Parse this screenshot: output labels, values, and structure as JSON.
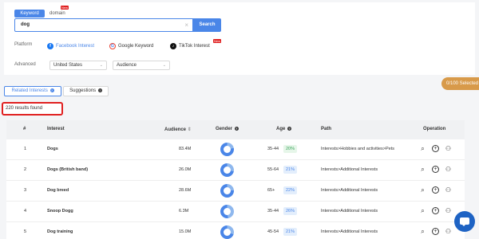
{
  "search": {
    "tabs": [
      "Keyword",
      "domain"
    ],
    "new_badge": "New",
    "query": "dog",
    "button_label": "Search"
  },
  "platform": {
    "label": "Platform",
    "items": [
      "Facebook Interest",
      "Google Keyword",
      "TikTok Interest"
    ],
    "new_badge": "New"
  },
  "advanced": {
    "label": "Advanced",
    "country": "United States",
    "audience": "Audience"
  },
  "tabs": {
    "related": "Related Interests",
    "suggestions": "Suggestions"
  },
  "selected": "0/100 Selected",
  "results_text": "220 results found",
  "table": {
    "headers": [
      "#",
      "Interest",
      "Audience",
      "Gender",
      "Age",
      "Path",
      "Operation"
    ],
    "rows": [
      {
        "num": "1",
        "interest": "Dogs",
        "audience": "83.4M",
        "age": "35-44",
        "pct": "20%",
        "path": "Interests>Hobbies and activities>Pets",
        "gender_male_pct": 22
      },
      {
        "num": "2",
        "interest": "Dogs (British band)",
        "audience": "26.0M",
        "age": "55-64",
        "pct": "21%",
        "path": "Interests>Additional Interests",
        "gender_male_pct": 28
      },
      {
        "num": "3",
        "interest": "Dog breed",
        "audience": "28.6M",
        "age": "65+",
        "pct": "22%",
        "path": "Interests>Additional Interests",
        "gender_male_pct": 24
      },
      {
        "num": "4",
        "interest": "Snoop Dogg",
        "audience": "6.3M",
        "age": "35-44",
        "pct": "26%",
        "path": "Interests>Additional Interests",
        "gender_male_pct": 48
      },
      {
        "num": "5",
        "interest": "Dog training",
        "audience": "15.0M",
        "age": "45-54",
        "pct": "21%",
        "path": "Interests>Additional Interests",
        "gender_male_pct": 30
      }
    ]
  },
  "colors": {
    "accent": "#4a86e8",
    "green_pct": "#e6f6e9",
    "blue_pct": "#e3eefc",
    "selected_pill": "#d89a4a"
  }
}
